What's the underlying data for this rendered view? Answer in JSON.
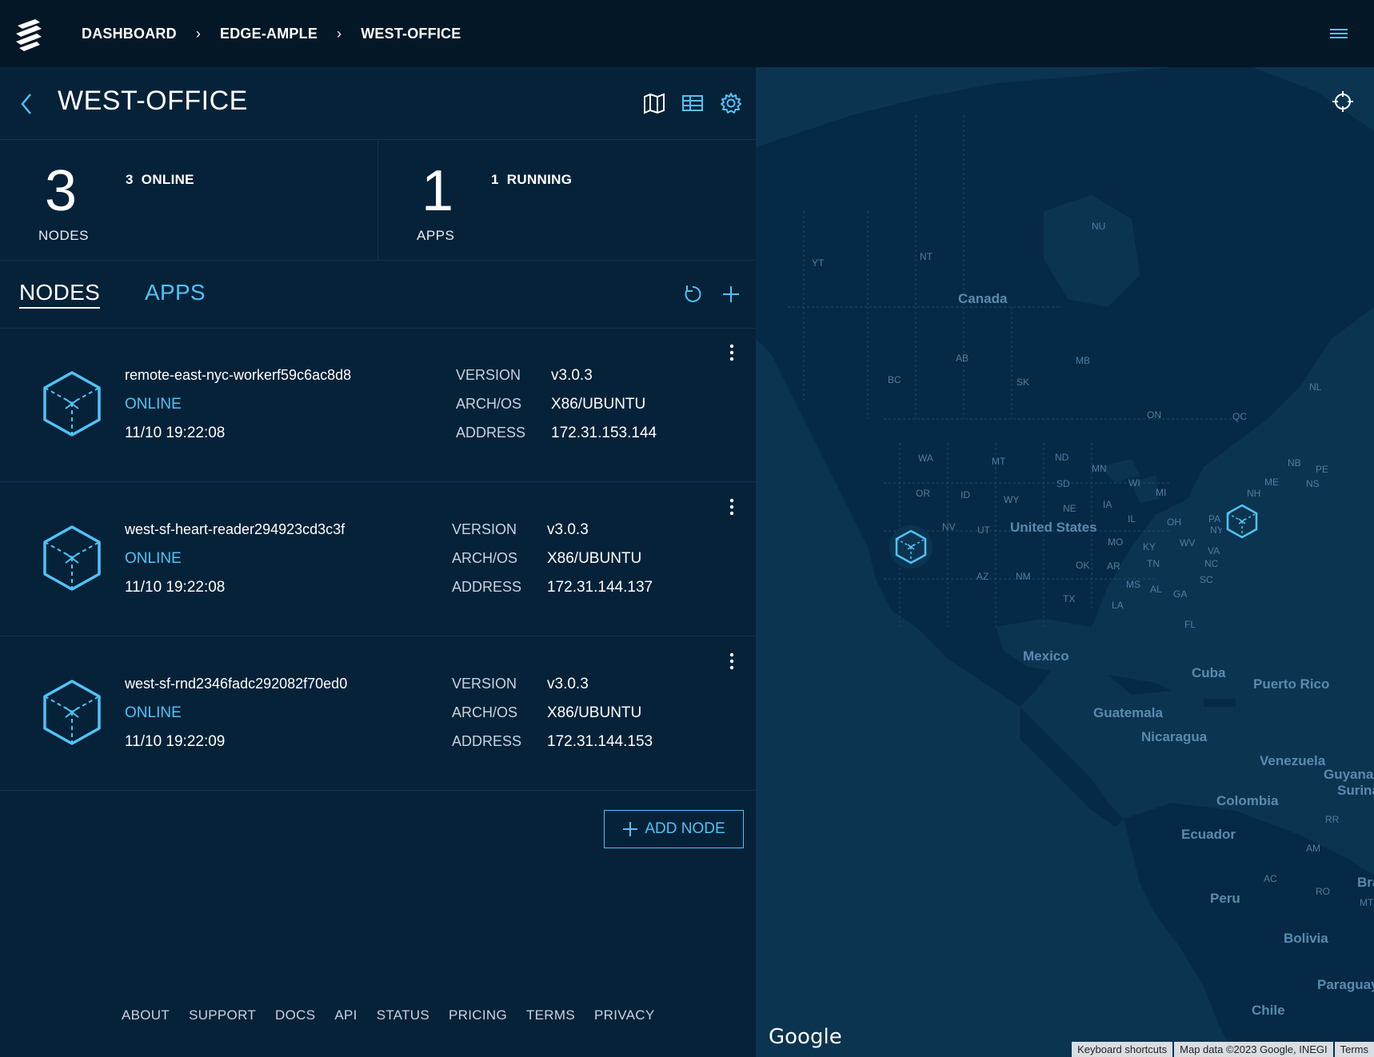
{
  "breadcrumb": {
    "items": [
      "DASHBOARD",
      "EDGE-AMPLE",
      "WEST-OFFICE"
    ]
  },
  "header": {
    "title": "WEST-OFFICE"
  },
  "stats": {
    "nodes": {
      "count": "3",
      "label": "NODES",
      "sub": "3  ONLINE"
    },
    "apps": {
      "count": "1",
      "label": "APPS",
      "sub": "1  RUNNING"
    }
  },
  "tabs": {
    "nodes": "NODES",
    "apps": "APPS"
  },
  "labels": {
    "version": "VERSION",
    "arch": "ARCH/OS",
    "address": "ADDRESS"
  },
  "nodes": [
    {
      "name": "remote-east-nyc-workerf59c6ac8d8",
      "status": "ONLINE",
      "time": "11/10 19:22:08",
      "version": "v3.0.3",
      "arch": "X86/UBUNTU",
      "address": "172.31.153.144"
    },
    {
      "name": "west-sf-heart-reader294923cd3c3f",
      "status": "ONLINE",
      "time": "11/10 19:22:08",
      "version": "v3.0.3",
      "arch": "X86/UBUNTU",
      "address": "172.31.144.137"
    },
    {
      "name": "west-sf-rnd2346fadc292082f70ed0",
      "status": "ONLINE",
      "time": "11/10 19:22:09",
      "version": "v3.0.3",
      "arch": "X86/UBUNTU",
      "address": "172.31.144.153"
    }
  ],
  "add_node": "ADD NODE",
  "footer": [
    "ABOUT",
    "SUPPORT",
    "DOCS",
    "API",
    "STATUS",
    "PRICING",
    "TERMS",
    "PRIVACY"
  ],
  "map": {
    "labels_large": [
      "Canada",
      "United States",
      "Mexico",
      "Cuba",
      "Puerto Rico",
      "Guatemala",
      "Nicaragua",
      "Venezuela",
      "Guyana",
      "Surina",
      "Colombia",
      "Ecuador",
      "Peru",
      "Bolivia",
      "Braz",
      "Paraguay",
      "Chile"
    ],
    "labels_small": [
      "YT",
      "NT",
      "NU",
      "BC",
      "AB",
      "SK",
      "MB",
      "ON",
      "QC",
      "NL",
      "WA",
      "OR",
      "ID",
      "MT",
      "WY",
      "ND",
      "SD",
      "NE",
      "MN",
      "IA",
      "WI",
      "MI",
      "IL",
      "OH",
      "NV",
      "UT",
      "AZ",
      "NM",
      "OK",
      "TX",
      "MO",
      "AR",
      "KY",
      "TN",
      "MS",
      "AL",
      "GA",
      "LA",
      "FL",
      "SC",
      "NC",
      "VA",
      "WV",
      "PA",
      "NY",
      "NH",
      "ME",
      "NB",
      "NS",
      "PE",
      "AM",
      "AC",
      "RO",
      "MT",
      "RR"
    ],
    "google": "Google",
    "attribution": [
      "Keyboard shortcuts",
      "Map data ©2023 Google, INEGI",
      "Terms"
    ]
  },
  "colors": {
    "accent": "#4fc3f7",
    "panel": "#062239",
    "topbar": "#031727",
    "map_water": "#0b3450",
    "map_land": "#062a45"
  }
}
